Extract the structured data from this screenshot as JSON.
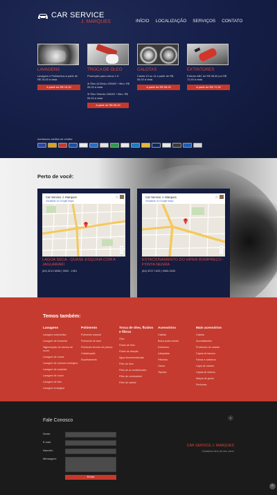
{
  "header": {
    "logo_title": "CAR SERVICE",
    "logo_subtitle": "J. MARQUES",
    "nav": [
      "INÍCIO",
      "LOCALIZAÇÃO",
      "SERVIÇOS",
      "CONTATO"
    ]
  },
  "services": [
    {
      "title": "LAVAGENS",
      "description": "Lavagem e Polimentos a partir de R$ 15,00 à vista",
      "button": "A partir de R$ 15,00",
      "thumb_icon": "car-wash-icon"
    },
    {
      "title": "TROCA DE ÓLEO",
      "description": "Promoção para carros 1.0:\n\n3l Óleo ACDelco 20W50 + filtro: R$ 55,00 à vista\n\n3l Óleo Selenia 15W40 + filtro: R$ 59,90 à vista",
      "button": "A partir de R$ 55,00",
      "thumb_icon": "oil-change-icon"
    },
    {
      "title": "CALOTAS",
      "description": "Calota 13 ou 14 a partir de R$ 55,00 à vista",
      "button": "A partir de R$ 55,00",
      "thumb_icon": "hubcap-icon"
    },
    {
      "title": "EXTINTORES",
      "description": "Extintor ABC de R$ 98,00 por R$ 72,90 à vista",
      "button": "A partir de R$ 72,90",
      "thumb_icon": "extinguisher-icon"
    }
  ],
  "payment": {
    "label": "Aceitamos cartões de crédito:",
    "cards": [
      "#2c4aa3",
      "#d8a21e",
      "#c73a2f",
      "#1d4e9d",
      "#e9e9e9",
      "#2a6cc0",
      "#e2e2e2",
      "#2d9b4a",
      "#e8e8e8",
      "#1d7abf",
      "#e5b73b",
      "#0f2a5a",
      "#e6e6e6",
      "#3a3a3a",
      "#1f5db0",
      "#d5d5d5"
    ]
  },
  "near": {
    "heading": "Perto de você:",
    "locations": [
      {
        "map_name": "Car Service J. Marques",
        "map_link": "Visualizar no Google Maps",
        "title": "LAGOA SECA - QUASE ESQUINA COM A JAGUARARI",
        "phone": "(84) 3213 6558 | 3053 - 1961"
      },
      {
        "map_name": "Car Service J. Marques",
        "map_link": "Visualizar no Google Maps",
        "title": "ESTACIONAMENTO DO HIPER BOMPREÇO - PONTA NEGRA",
        "phone": "(84) 3237 1325 | 9983-3333"
      }
    ]
  },
  "also": {
    "heading": "Temos também:",
    "columns": [
      {
        "title": "Lavagens",
        "items": [
          "Lavagem automotiva",
          "Lavagem de borracha",
          "Higienização de bancos de couro",
          "Lavagem de motos",
          "Lavagem de motores ecológica",
          "Lavagem de carpetes",
          "Lavagem de motor",
          "Lavagem de teto",
          "Lavagem ecológica"
        ]
      },
      {
        "title": "Polimento",
        "items": [
          "Polimento manual",
          "Polimento de farol",
          "Polimento técnico de pintura",
          "Cristalização",
          "Espelhamento"
        ]
      },
      {
        "title": "Troca de óleo, fluidos e filtros",
        "items": [
          "Óleo",
          "Fluido de freio",
          "Fluido de direção",
          "Água desmineralizada",
          "Filtro de óleo",
          "Filtro de ar condicionado",
          "Filtro de combustível",
          "Filtro de cabine"
        ]
      },
      {
        "title": "Acessórios",
        "items": [
          "Calotas",
          "Bolsa porta-celular",
          "Extintores",
          "Lâmpadas",
          "Palhetas",
          "Cintos",
          "Tapetes"
        ]
      },
      {
        "title": "Mais acessórios",
        "items": [
          "Calotas",
          "Aromatizantes",
          "Protetores de volante",
          "Capas de bancos",
          "Faixas e adesivos",
          "Capa de volante",
          "Capas de chaves",
          "Maços de goma",
          "Perfumes"
        ]
      }
    ]
  },
  "contact": {
    "heading": "Fale Conosco",
    "fields": [
      "Nome:",
      "E-mail:",
      "Assunto:",
      "Mensagem:"
    ],
    "send": "Enviar",
    "brand": "CAR SERVICE J. MARQUES",
    "brand_sub": "Cuidados bem do seu carro",
    "top_icon": "arrow-up-icon",
    "corner_icon": "share-icon"
  }
}
